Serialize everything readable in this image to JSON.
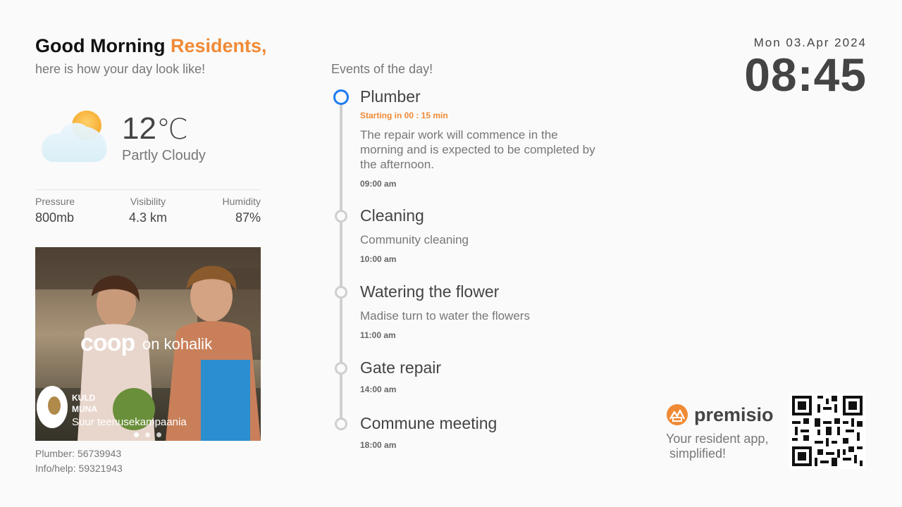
{
  "greeting": {
    "prefix": "Good Morning",
    "name": "Residents,",
    "subtitle": "here is how your day look like!"
  },
  "weather": {
    "icon": "partly-cloudy-icon",
    "temperature": "12",
    "unit": "℃",
    "condition": "Partly Cloudy",
    "stats": [
      {
        "label": "Pressure",
        "value": "800mb"
      },
      {
        "label": "Visibility",
        "value": "4.3 km"
      },
      {
        "label": "Humidity",
        "value": "87%"
      }
    ]
  },
  "ad": {
    "brand": "coop",
    "brand_suffix": "on kohalik",
    "badge_line1": "KULD",
    "badge_line2": "MUNA",
    "tagline": "Suur teenusekampaania",
    "slides": 3,
    "active_slide": 0
  },
  "contacts": {
    "plumber": "Plumber: 56739943",
    "info": "Info/help: 59321943"
  },
  "events": {
    "title": "Events of the day!",
    "items": [
      {
        "title": "Plumber",
        "starting": "Starting in 00 : 15 min",
        "description": "The repair work will commence in the morning and is expected to be completed by the afternoon.",
        "time": "09:00 am",
        "active": true
      },
      {
        "title": "Cleaning",
        "description": "Community cleaning",
        "time": "10:00 am"
      },
      {
        "title": "Watering the flower",
        "description": "Madise turn to water the flowers",
        "time": "11:00 am"
      },
      {
        "title": "Gate repair",
        "time": "14:00 am"
      },
      {
        "title": "Commune meeting",
        "time": "18:00 am"
      }
    ]
  },
  "datetime": {
    "date": "Mon 03.Apr 2024",
    "time": "08:45"
  },
  "brand": {
    "name": "premisio",
    "tagline": "Your resident app,\n simplified!",
    "logo_color": "#f08a35"
  },
  "colors": {
    "accent": "#f08a35",
    "active": "#1e7bf0"
  }
}
